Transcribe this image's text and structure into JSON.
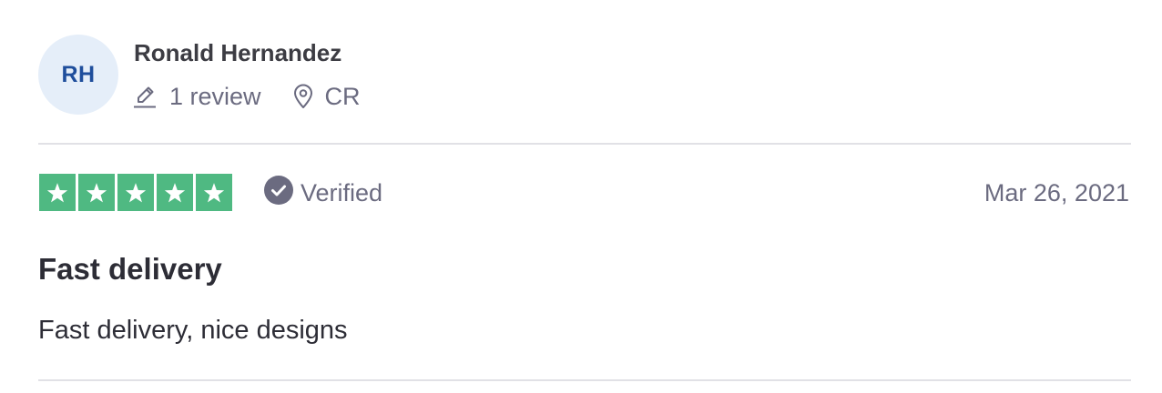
{
  "consumer": {
    "initials": "RH",
    "name": "Ronald Hernandez",
    "review_count": "1 review",
    "country": "CR",
    "avatar_bg": "#e5eef9",
    "avatar_color": "#1f4e9c"
  },
  "review": {
    "rating": 5,
    "rating_max": 5,
    "star_color": "#4fb982",
    "verified_label": "Verified",
    "date": "Mar 26, 2021",
    "title": "Fast delivery",
    "body": "Fast delivery, nice designs"
  },
  "icons": {
    "review_count": "pencil-icon",
    "location": "location-pin-icon",
    "verified": "check-circle-icon",
    "star": "star-icon"
  }
}
